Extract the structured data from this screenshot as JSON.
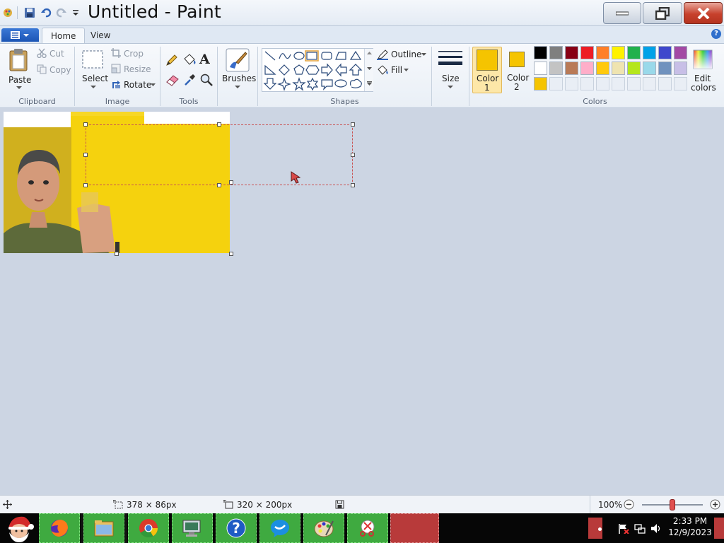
{
  "window": {
    "title": "Untitled - Paint"
  },
  "tabs": {
    "home": "Home",
    "view": "View"
  },
  "clipboard": {
    "paste": "Paste",
    "cut": "Cut",
    "copy": "Copy",
    "group": "Clipboard"
  },
  "image": {
    "select": "Select",
    "crop": "Crop",
    "resize": "Resize",
    "rotate": "Rotate",
    "group": "Image"
  },
  "tools": {
    "group": "Tools"
  },
  "brushes": {
    "label": "Brushes"
  },
  "shapes": {
    "outline": "Outline",
    "fill": "Fill",
    "group": "Shapes"
  },
  "size": {
    "label": "Size"
  },
  "colors": {
    "color1": "Color",
    "color1_num": "1",
    "color2": "Color",
    "color2_num": "2",
    "edit1": "Edit",
    "edit2": "colors",
    "group": "Colors",
    "color1_value": "#f5c400",
    "color2_value": "#f5c400",
    "palette": [
      "#000000",
      "#7f7f7f",
      "#880015",
      "#ed1c24",
      "#ff7f27",
      "#fff200",
      "#22b14c",
      "#00a2e8",
      "#3f48cc",
      "#a349a4",
      "#ffffff",
      "#c3c3c3",
      "#b97a57",
      "#ffaec9",
      "#ffc90e",
      "#efe4b0",
      "#b5e61d",
      "#99d9ea",
      "#7092be",
      "#c8bfe7"
    ],
    "custom": [
      "#f5c400"
    ]
  },
  "status": {
    "selection_size": "378 × 86px",
    "image_size": "320 × 200px",
    "zoom": "100%",
    "zoom_fraction": 0.5
  },
  "taskbar": {
    "time": "2:33 PM",
    "date": "12/9/2023"
  }
}
